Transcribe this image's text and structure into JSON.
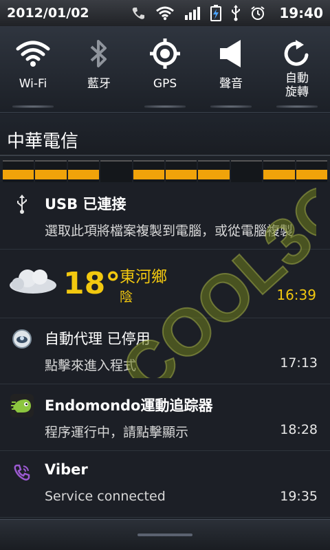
{
  "status_bar": {
    "date": "2012/01/02",
    "time": "19:40",
    "icons": [
      "viber-call-icon",
      "wifi-icon",
      "signal-icon",
      "battery-charging-icon",
      "usb-icon",
      "alarm-icon"
    ]
  },
  "quick_toggles": [
    {
      "label": "Wi-Fi",
      "icon": "wifi-icon",
      "active": true
    },
    {
      "label": "藍牙",
      "icon": "bluetooth-icon",
      "active": false
    },
    {
      "label": "GPS",
      "icon": "gps-icon",
      "active": true
    },
    {
      "label": "聲音",
      "icon": "speaker-icon",
      "active": true
    },
    {
      "label": "自動\n旋轉",
      "icon": "rotate-icon",
      "active": true
    }
  ],
  "carrier": "中華電信",
  "signal_strip_filled": [
    true,
    true,
    true,
    false,
    true,
    true,
    true,
    false,
    true,
    true
  ],
  "notifications": {
    "usb": {
      "title": "USB 已連接",
      "subtitle": "選取此項將檔案複製到電腦，或從電腦複製"
    },
    "weather": {
      "temp": "18°",
      "city": "東河鄉",
      "condition": "陰",
      "time": "16:39"
    },
    "proxy": {
      "title": "自動代理 已停用",
      "subtitle": "點擊來進入程式",
      "time": "17:13"
    },
    "endomondo": {
      "title": "Endomondo運動追踪器",
      "subtitle": "程序運行中，請點擊顯示",
      "time": "18:28"
    },
    "viber": {
      "title": "Viber",
      "subtitle": "Service connected",
      "time": "19:35"
    }
  },
  "watermark": "COOL3C",
  "colors": {
    "accent_yellow": "#f2c80f",
    "signal_orange": "#f0a30a",
    "watermark_green": "#6f7d1e"
  }
}
